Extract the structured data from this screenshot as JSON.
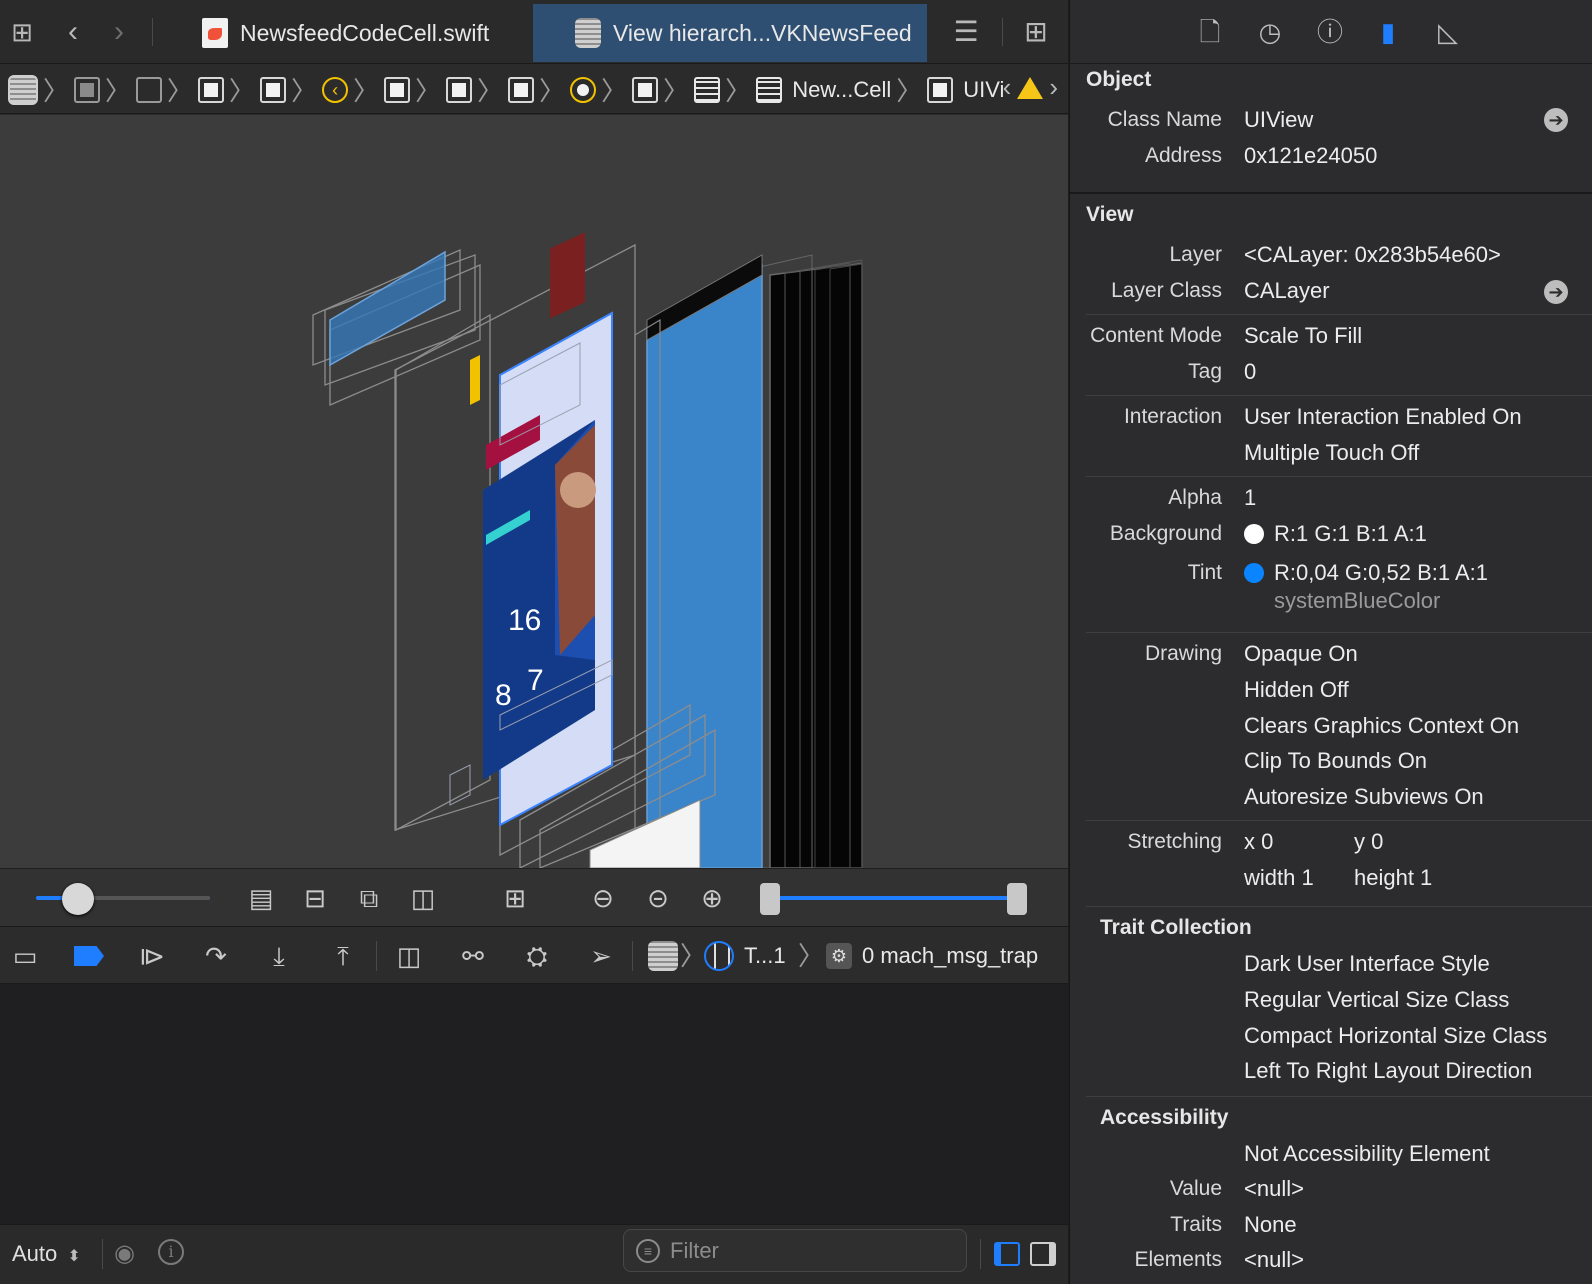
{
  "tabs": [
    {
      "label": "NewsfeedCodeCell.swift",
      "icon": "swift-file-icon"
    },
    {
      "label": "View hierarch...VKNewsFeed",
      "icon": "view-hierarchy-icon"
    }
  ],
  "jumpbar": {
    "cell_label": "New...Cell",
    "view_label": "UIView"
  },
  "debug_bar": {
    "thread_label": "T...1",
    "frame_label": "0 mach_msg_trap"
  },
  "console": {
    "mode_label": "Auto",
    "filter_placeholder": "Filter"
  },
  "inspector": {
    "object": {
      "title": "Object",
      "class_name_label": "Class Name",
      "class_name": "UIView",
      "address_label": "Address",
      "address": "0x121e24050"
    },
    "view": {
      "title": "View",
      "layer_label": "Layer",
      "layer": "<CALayer: 0x283b54e60>",
      "layer_class_label": "Layer Class",
      "layer_class": "CALayer",
      "content_mode_label": "Content Mode",
      "content_mode": "Scale To Fill",
      "tag_label": "Tag",
      "tag": "0",
      "interaction_label": "Interaction",
      "interaction_1": "User Interaction Enabled On",
      "interaction_2": "Multiple Touch Off",
      "alpha_label": "Alpha",
      "alpha": "1",
      "background_label": "Background",
      "background": "R:1 G:1 B:1 A:1",
      "background_color": "#ffffff",
      "tint_label": "Tint",
      "tint": "R:0,04 G:0,52 B:1 A:1",
      "tint_name": "systemBlueColor",
      "tint_color": "#0a84ff",
      "drawing_label": "Drawing",
      "drawing_1": "Opaque On",
      "drawing_2": "Hidden Off",
      "drawing_3": "Clears Graphics Context On",
      "drawing_4": "Clip To Bounds On",
      "drawing_5": "Autoresize Subviews On",
      "stretching_label": "Stretching",
      "stretch_x": "x  0",
      "stretch_y": "y  0",
      "stretch_w": "width  1",
      "stretch_h": "height  1"
    },
    "traits": {
      "title": "Trait Collection",
      "t1": "Dark User Interface Style",
      "t2": "Regular Vertical Size Class",
      "t3": "Compact Horizontal Size Class",
      "t4": "Left To Right Layout Direction"
    },
    "accessibility": {
      "title": "Accessibility",
      "a1": "Not Accessibility Element",
      "value_label": "Value",
      "value": "<null>",
      "traits_label": "Traits",
      "traits": "None",
      "elements_label": "Elements",
      "elements": "<null>"
    }
  },
  "colors": {
    "accent": "#1f7dff",
    "view_blue": "#3a84c9",
    "selection": "#2f4f72"
  }
}
